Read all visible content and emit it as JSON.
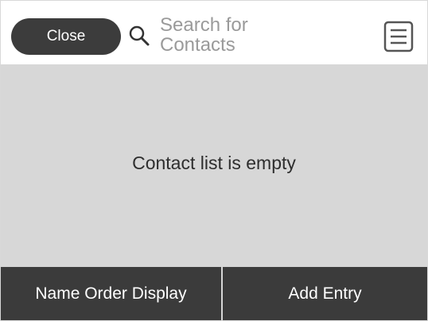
{
  "header": {
    "close_label": "Close",
    "search_placeholder": "Search for Contacts",
    "menu_icon": "list-menu-icon",
    "search_icon": "search-icon"
  },
  "main": {
    "empty_message": "Contact list is empty"
  },
  "footer": {
    "name_order_label": "Name Order Display",
    "add_entry_label": "Add Entry"
  },
  "colors": {
    "close_button_bg": "#3c3c3c",
    "content_bg": "#d7d7d7",
    "footer_bg": "#3b3b3b",
    "placeholder": "#9a9a9a"
  }
}
